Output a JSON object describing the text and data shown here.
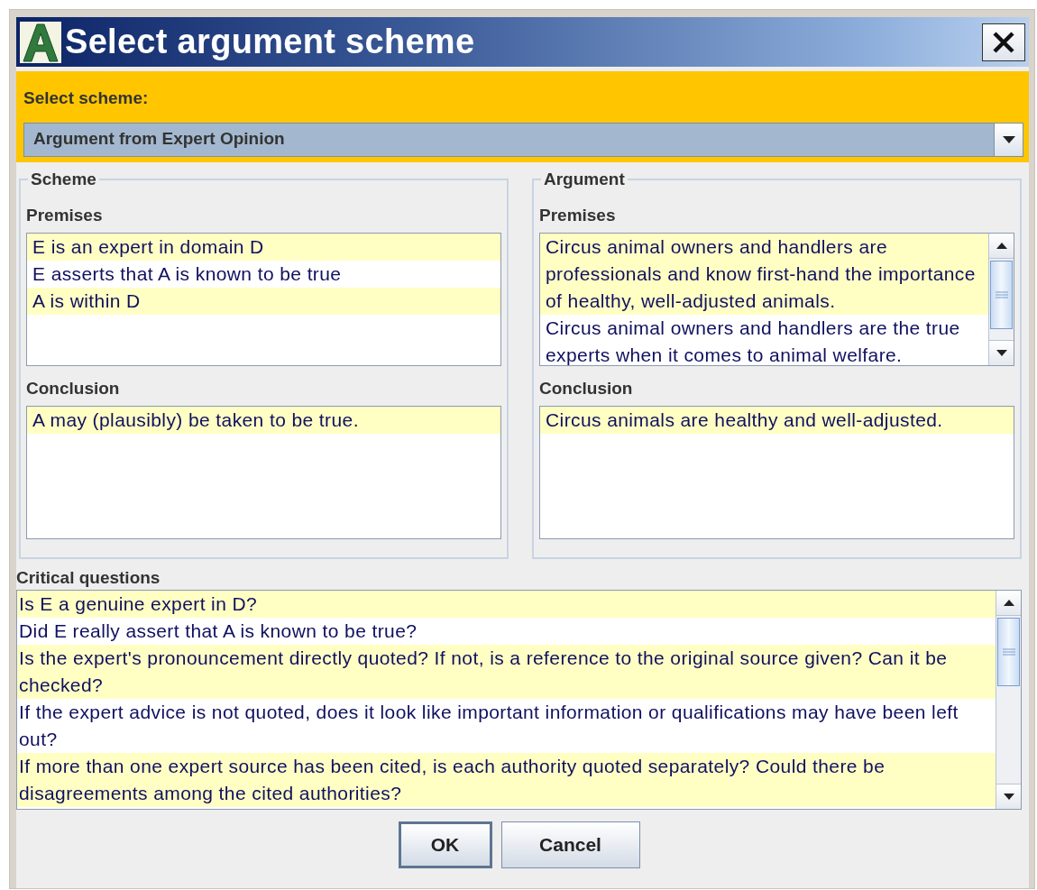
{
  "window": {
    "title": "Select argument scheme"
  },
  "scheme_selector": {
    "label": "Select scheme:",
    "value": "Argument from Expert Opinion"
  },
  "scheme": {
    "title": "Scheme",
    "premises_label": "Premises",
    "premises": [
      "E is an expert in domain D",
      "E asserts that A is known to be true",
      "A is within D"
    ],
    "conclusion_label": "Conclusion",
    "conclusion": [
      "A may (plausibly) be taken to be true."
    ]
  },
  "argument": {
    "title": "Argument",
    "premises_label": "Premises",
    "premises": [
      "Circus animal owners and handlers are professionals and know first-hand the importance of healthy, well-adjusted animals.",
      "Circus animal owners and handlers are the true experts when it comes to animal welfare."
    ],
    "conclusion_label": "Conclusion",
    "conclusion": [
      "Circus animals are healthy and well-adjusted."
    ]
  },
  "critical_questions": {
    "label": "Critical questions",
    "items": [
      "Is E a genuine expert in D?",
      "Did E really assert that A is known to be true?",
      "Is the expert's pronouncement directly quoted? If not, is a reference to the original source given? Can it be checked?",
      "If the expert advice is not quoted, does it look like important information or qualifications may have been left out?",
      "If more than one expert source has been cited, is each authority quoted separately? Could there be disagreements among the cited authorities?"
    ]
  },
  "buttons": [
    {
      "label": "OK",
      "default": true
    },
    {
      "label": "Cancel",
      "default": false
    }
  ]
}
